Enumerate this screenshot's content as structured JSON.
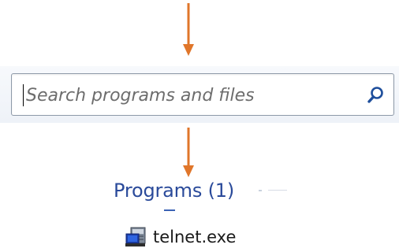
{
  "search": {
    "placeholder": "Search programs and files",
    "value": "",
    "icon": "search-icon"
  },
  "results": {
    "group_title": "Programs (1)",
    "items": [
      {
        "label": "telnet.exe",
        "icon": "terminal-app-icon"
      }
    ]
  },
  "annotations": {
    "arrow_color": "#e0762a",
    "arrows": [
      "down-arrow",
      "down-arrow"
    ]
  },
  "colors": {
    "group_title": "#2a4a9a",
    "search_border": "#8e9aa9",
    "search_text": "#6d6d6d"
  }
}
